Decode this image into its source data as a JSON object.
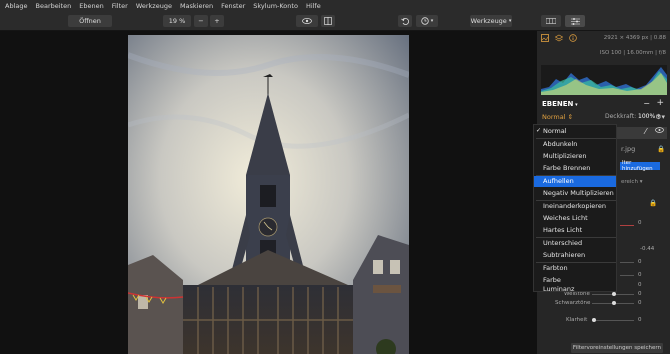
{
  "menu": [
    "Ablage",
    "Bearbeiten",
    "Ebenen",
    "Filter",
    "Werkzeuge",
    "Maskieren",
    "Fenster",
    "Skylum-Konto",
    "Hilfe"
  ],
  "toolbar": {
    "open_label": "Öffnen",
    "zoom": "19 %",
    "minus": "−",
    "plus": "+",
    "tools_label": "Werkzeuge"
  },
  "histogram": {
    "size": "2921 × 4369 px | 0.88",
    "exif": "ISO 100 | 16.00mm | f/8"
  },
  "layers": {
    "title": "EBENEN",
    "blend_mode": "Normal",
    "opacity_label": "Deckkraft:",
    "opacity_value": "100%",
    "file_suffix": "r.jpg",
    "add_filter": "lter hinzufügen",
    "bereich": "ereich"
  },
  "blend_modes": [
    {
      "label": "Normal",
      "checked": true
    },
    {
      "label": "Abdunkeln"
    },
    {
      "label": "Multiplizieren"
    },
    {
      "label": "Farbe Brennen"
    },
    {
      "label": "Aufhellen",
      "selected": true
    },
    {
      "label": "Negativ Multiplizieren"
    },
    {
      "label": "Ineinanderkopieren"
    },
    {
      "label": "Weiches Licht"
    },
    {
      "label": "Hartes Licht"
    },
    {
      "label": "Unterschied"
    },
    {
      "label": "Subtrahieren"
    },
    {
      "label": "Farbton"
    },
    {
      "label": "Farbe"
    },
    {
      "label": "Luminanz"
    }
  ],
  "sliders": {
    "weiss_label": "Weißtöne",
    "schwarz_label": "Schwarztöne",
    "klarheit_label": "Klarheit",
    "zero": "0",
    "neg_value": "-0.44"
  },
  "footer": {
    "save_filter": "Filtervoreinstellungen speichern"
  },
  "colors": {
    "accent": "#1a6ae0",
    "blend": "#e0a040"
  }
}
